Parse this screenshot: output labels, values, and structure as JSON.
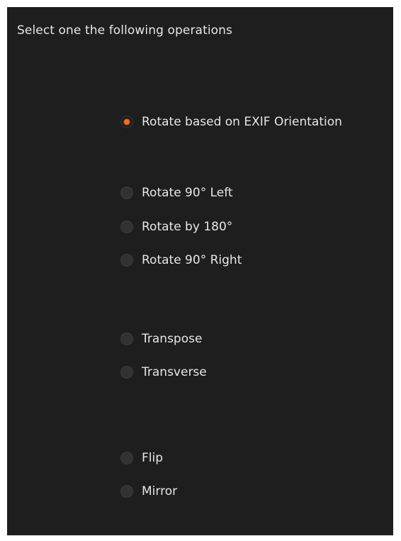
{
  "dialog": {
    "heading": "Select one the following operations"
  },
  "options": [
    {
      "id": "rotate-exif",
      "label": "Rotate based on EXIF Orientation",
      "checked": true
    },
    {
      "id": "rotate-left",
      "label": "Rotate 90° Left",
      "checked": false,
      "mnemonic": "L"
    },
    {
      "id": "rotate-180",
      "label": "Rotate by 180°",
      "checked": false,
      "mnemonic": "R"
    },
    {
      "id": "rotate-right",
      "label": "Rotate 90° Right",
      "checked": false,
      "mnemonic": "R"
    },
    {
      "id": "transpose",
      "label": "Transpose",
      "checked": false,
      "mnemonic": "T"
    },
    {
      "id": "transverse",
      "label": "Transverse",
      "checked": false,
      "mnemonic": "v"
    },
    {
      "id": "flip",
      "label": "Flip",
      "checked": false,
      "mnemonic": "F"
    },
    {
      "id": "mirror",
      "label": "Mirror",
      "checked": false,
      "mnemonic": "M"
    }
  ],
  "colors": {
    "background": "#1e1e1f",
    "text": "#e6e6e6",
    "accent": "#f26d21"
  }
}
